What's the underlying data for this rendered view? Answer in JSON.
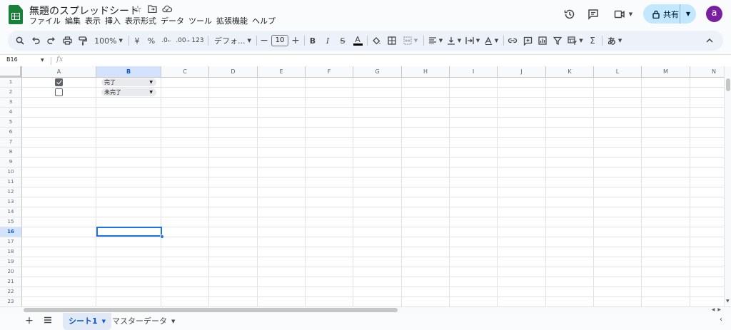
{
  "app": {
    "doc_title": "無題のスプレッドシート",
    "menus": [
      "ファイル",
      "編集",
      "表示",
      "挿入",
      "表示形式",
      "データ",
      "ツール",
      "拡張機能",
      "ヘルプ"
    ],
    "share_label": "共有",
    "avatar_letter": "a"
  },
  "toolbar": {
    "zoom": "100%",
    "currency": "¥",
    "percent": "%",
    "decrease_decimal": ".0",
    "increase_decimal": ".00",
    "format_123": "123",
    "font": "デフォ...",
    "font_size": "10",
    "bold": "B",
    "italic": "I",
    "strike": "S",
    "text_color": "A",
    "sigma": "Σ",
    "input_mode": "あ"
  },
  "formula_bar": {
    "cell_ref": "B16",
    "fx": "fx"
  },
  "grid": {
    "columns": [
      "A",
      "B",
      "C",
      "D",
      "E",
      "F",
      "G",
      "H",
      "I",
      "J",
      "K",
      "L",
      "M",
      "N"
    ],
    "selected_column": "B",
    "selected_row": 16,
    "rows": [
      "1",
      "2",
      "3",
      "4",
      "5",
      "6",
      "7",
      "8",
      "9",
      "10",
      "11",
      "12",
      "13",
      "14",
      "15",
      "16",
      "17",
      "18",
      "19",
      "20",
      "21",
      "22",
      "23"
    ],
    "cells": [
      {
        "row": 1,
        "checkbox_checked": true,
        "status": "完了"
      },
      {
        "row": 2,
        "checkbox_checked": false,
        "status": "未完了"
      }
    ]
  },
  "sheets": {
    "tabs": [
      "シート1",
      "マスターデータ"
    ],
    "active": "シート1"
  },
  "colors": {
    "accent": "#1a73e8",
    "share_bg": "#c2e7ff",
    "logo": "#188038",
    "avatar": "#7b1fa2"
  }
}
